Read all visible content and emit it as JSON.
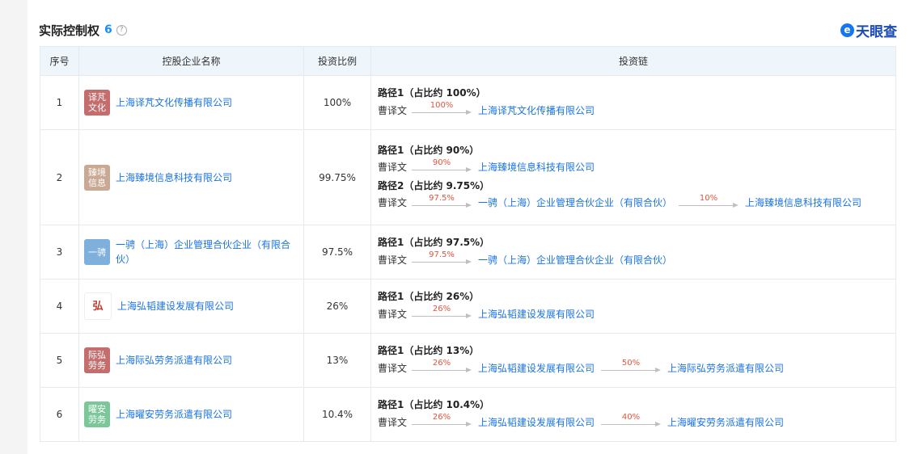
{
  "section": {
    "title": "实际控制权",
    "count": "6",
    "help_icon": "question-circle-icon"
  },
  "brand": {
    "logo_icon": "tianyancha-logo-icon",
    "logo_glyph": "e",
    "name": "天眼查"
  },
  "table": {
    "headers": {
      "index": "序号",
      "company": "控股企业名称",
      "ratio": "投资比例",
      "chain": "投资链"
    },
    "rows": [
      {
        "index": "1",
        "logo_text": [
          "译芃",
          "文化"
        ],
        "logo_color": "#c56d6d",
        "company": "上海译芃文化传播有限公司",
        "ratio": "100%",
        "paths": [
          {
            "title": "路径1（占比约 100%）",
            "person": "曹译文",
            "steps": [
              {
                "pct": "100%",
                "to": "上海译芃文化传播有限公司"
              }
            ]
          }
        ]
      },
      {
        "index": "2",
        "logo_text": [
          "臻境",
          "信息"
        ],
        "logo_color": "#c9a894",
        "company": "上海臻境信息科技有限公司",
        "ratio": "99.75%",
        "paths": [
          {
            "title": "路径1（占比约 90%）",
            "person": "曹译文",
            "steps": [
              {
                "pct": "90%",
                "to": "上海臻境信息科技有限公司"
              }
            ]
          },
          {
            "title": "路径2（占比约 9.75%）",
            "person": "曹译文",
            "steps": [
              {
                "pct": "97.5%",
                "to": "一骋（上海）企业管理合伙企业（有限合伙）"
              },
              {
                "pct": "10%",
                "to": "上海臻境信息科技有限公司"
              }
            ]
          }
        ]
      },
      {
        "index": "3",
        "logo_text": [
          "一骋"
        ],
        "logo_color": "#7fb0dc",
        "company": "一骋（上海）企业管理合伙企业（有限合伙）",
        "ratio": "97.5%",
        "paths": [
          {
            "title": "路径1（占比约 97.5%）",
            "person": "曹译文",
            "steps": [
              {
                "pct": "97.5%",
                "to": "一骋（上海）企业管理合伙企业（有限合伙）"
              }
            ]
          }
        ]
      },
      {
        "index": "4",
        "logo_text": [
          "弘"
        ],
        "logo_color": "seal",
        "company": "上海弘韬建设发展有限公司",
        "ratio": "26%",
        "paths": [
          {
            "title": "路径1（占比约 26%）",
            "person": "曹译文",
            "steps": [
              {
                "pct": "26%",
                "to": "上海弘韬建设发展有限公司"
              }
            ]
          }
        ]
      },
      {
        "index": "5",
        "logo_text": [
          "际弘",
          "劳务"
        ],
        "logo_color": "#c56d6d",
        "company": "上海际弘劳务派遣有限公司",
        "ratio": "13%",
        "paths": [
          {
            "title": "路径1（占比约 13%）",
            "person": "曹译文",
            "steps": [
              {
                "pct": "26%",
                "to": "上海弘韬建设发展有限公司"
              },
              {
                "pct": "50%",
                "to": "上海际弘劳务派遣有限公司"
              }
            ]
          }
        ]
      },
      {
        "index": "6",
        "logo_text": [
          "曜安",
          "劳务"
        ],
        "logo_color": "#7cc79a",
        "company": "上海曜安劳务派遣有限公司",
        "ratio": "10.4%",
        "paths": [
          {
            "title": "路径1（占比约 10.4%）",
            "person": "曹译文",
            "steps": [
              {
                "pct": "26%",
                "to": "上海弘韬建设发展有限公司"
              },
              {
                "pct": "40%",
                "to": "上海曜安劳务派遣有限公司"
              }
            ]
          }
        ]
      }
    ]
  }
}
